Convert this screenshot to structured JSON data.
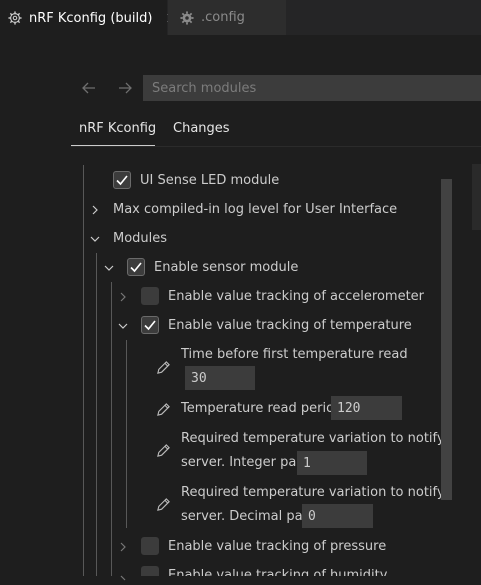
{
  "tabs": [
    {
      "label": "nRF Kconfig (build)",
      "icon": "gear-icon",
      "active": true,
      "close_icon": "close-icon"
    },
    {
      "label": ".config",
      "icon": "gear-icon",
      "active": false
    }
  ],
  "search": {
    "placeholder": "Search modules",
    "value": ""
  },
  "panel_tabs": [
    {
      "label": "nRF Kconfig",
      "active": true
    },
    {
      "label": "Changes",
      "active": false
    }
  ],
  "tree": {
    "ui_sense_led": "UI Sense LED module",
    "max_log_level": "Max compiled-in log level for User Interface",
    "modules": "Modules",
    "enable_sensor": "Enable sensor module",
    "accel": "Enable value tracking of accelerometer",
    "temp": "Enable value tracking of temperature",
    "time_first_read": "Time before first temperature read",
    "time_first_read_value": "30",
    "read_period": "Temperature read period",
    "read_period_value": "120",
    "var_int_line1": "Required temperature variation to notify",
    "var_int_line2": "server. Integer part",
    "var_int_value": "1",
    "var_dec_line1": "Required temperature variation to notify",
    "var_dec_line2": "server. Decimal part",
    "var_dec_value": "0",
    "pressure": "Enable value tracking of pressure",
    "humidity": "Enable value tracking of humidity"
  },
  "colors": {
    "accent": "#ffffff",
    "background": "#1e1e1e",
    "input": "#3c3c3c"
  }
}
